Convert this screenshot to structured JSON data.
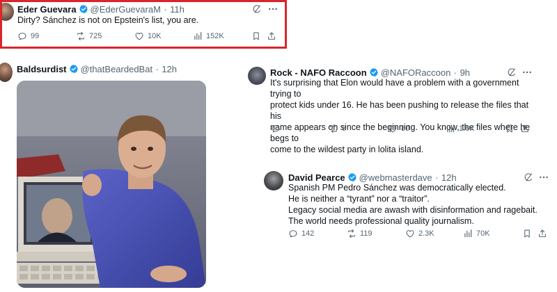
{
  "colors": {
    "red_frame": "#d9252b",
    "verified_blue": "#1d9bf0",
    "text": "#0f1419",
    "muted": "#536471"
  },
  "tweets": [
    {
      "name": "Eder Guevara",
      "handle": "@EderGuevaraM",
      "dot": "·",
      "time": "11h",
      "lines": [
        "Dirty? Sánchez is not on Epstein's list, you are."
      ],
      "stats": {
        "replies": "99",
        "reposts": "725",
        "likes": "10K",
        "views": "152K"
      }
    },
    {
      "name": "Baldsurdist",
      "handle": "@thatBeardedBat",
      "dot": "·",
      "time": "12h"
    },
    {
      "name": "Rock - NAFO Raccoon",
      "handle": "@NAFORaccoon",
      "dot": "·",
      "time": "9h",
      "lines": [
        "It's surprising that Elon would have a problem with a government trying to",
        "protect kids under 16. He has been pushing to release the files that his",
        "name appears on since the beginning. You know, the files where he begs to",
        "come to the wildest party in lolita island."
      ],
      "stats": {
        "replies": "",
        "reposts": "6",
        "likes": "80",
        "views": "1.6K"
      }
    },
    {
      "name": "David Pearce",
      "handle": "@webmasterdave",
      "dot": "·",
      "time": "12h",
      "lines": [
        "Spanish PM Pedro Sánchez was democratically elected.",
        "He is neither a “tyrant” nor a “traitor”.",
        "Legacy social media are awash with disinformation and ragebait.",
        "The world needs professional quality journalism."
      ],
      "stats": {
        "replies": "142",
        "reposts": "119",
        "likes": "2.3K",
        "views": "70K"
      }
    }
  ],
  "icons": [
    "grok-icon",
    "more-icon",
    "reply-icon",
    "repost-icon",
    "like-icon",
    "views-icon",
    "bookmark-icon",
    "share-icon",
    "verified-icon"
  ]
}
